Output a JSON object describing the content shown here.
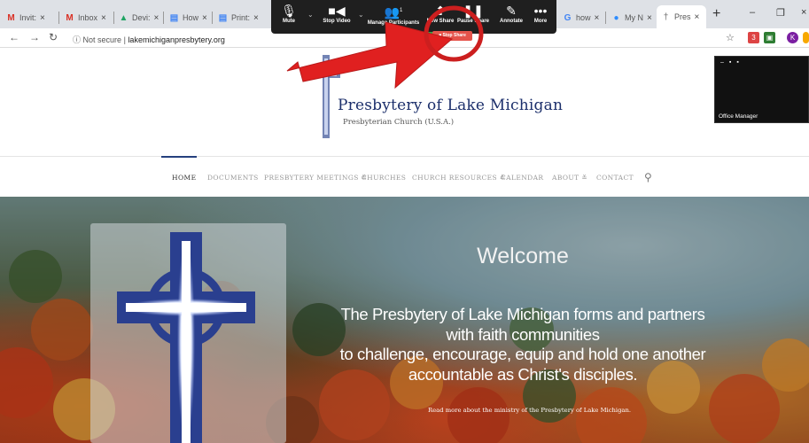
{
  "browser": {
    "tabs": [
      {
        "label": "Invit:",
        "favicon": "gmail-icon",
        "fav_glyph": "M",
        "fav_color": "#d93025"
      },
      {
        "label": "Inbox",
        "favicon": "gmail-icon",
        "fav_glyph": "M",
        "fav_color": "#d93025"
      },
      {
        "label": "Devi:",
        "favicon": "google-drive-icon",
        "fav_glyph": "▲",
        "fav_color": "#1fa463"
      },
      {
        "label": "How",
        "favicon": "google-docs-icon",
        "fav_glyph": "▤",
        "fav_color": "#4285f4"
      },
      {
        "label": "Print:",
        "favicon": "google-docs-icon",
        "fav_glyph": "▤",
        "fav_color": "#4285f4"
      },
      {
        "label": "how",
        "favicon": "google-icon",
        "fav_glyph": "G",
        "fav_color": "#4285f4"
      },
      {
        "label": "My N",
        "favicon": "meeting-icon",
        "fav_glyph": "●",
        "fav_color": "#2d8cff"
      },
      {
        "label": "Pres",
        "favicon": "presbytery-icon",
        "fav_glyph": "†",
        "fav_color": "#888"
      }
    ],
    "close_glyph": "×",
    "new_tab_glyph": "+",
    "minimize_glyph": "–",
    "restore_glyph": "❐",
    "address": {
      "security": "Not secure",
      "separator": "|",
      "host": "lakemichiganpresbytery.org"
    },
    "ext_badge": "3",
    "profile_initial": "K",
    "colors": {
      "tabstrip": "#dee1e6",
      "stop_share": "#e5534b",
      "share_green": "#2ea84b"
    }
  },
  "zoom_toolbar": {
    "participant_count": "1",
    "items": [
      {
        "label": "Mute",
        "icon": "microphone-icon"
      },
      {
        "label": "Stop Video",
        "icon": "video-camera-icon"
      },
      {
        "label": "Manage Participants",
        "icon": "participants-icon"
      },
      {
        "label": "New Share",
        "icon": "share-icon"
      },
      {
        "label": "Pause Share",
        "icon": "pause-icon"
      },
      {
        "label": "Annotate",
        "icon": "pencil-icon"
      },
      {
        "label": "More",
        "icon": "more-dots-icon"
      }
    ],
    "stop_share_label": "Stop Share"
  },
  "video_thumbnail": {
    "label": "Office Manager"
  },
  "site": {
    "title": "Presbytery of Lake Michigan",
    "subtitle": "Presbyterian Church (U.S.A.)",
    "menu": [
      {
        "label": "HOME",
        "active": true
      },
      {
        "label": "DOCUMENTS"
      },
      {
        "label": "PRESBYTERY MEETINGS ≚"
      },
      {
        "label": "CHURCHES"
      },
      {
        "label": "CHURCH RESOURCES ≚"
      },
      {
        "label": "CALENDAR"
      },
      {
        "label": "ABOUT ≚"
      },
      {
        "label": "CONTACT"
      }
    ],
    "accent": "#25407e"
  },
  "hero": {
    "heading": "Welcome",
    "mission_lines": [
      "The Presbytery of Lake Michigan forms and partners",
      "with faith communities",
      "to challenge, encourage, equip and hold one another",
      "accountable as Christ's disciples."
    ],
    "read_more": "Read more about the ministry of the Presbytery of Lake Michigan."
  },
  "annotation": {
    "arrow_color": "#e02020",
    "circle_color": "#cc1f1f"
  }
}
